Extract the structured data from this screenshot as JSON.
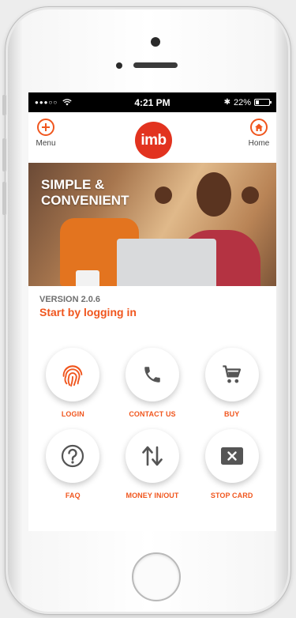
{
  "statusbar": {
    "time": "4:21 PM",
    "battery_text": "22%",
    "battery_level": 0.22
  },
  "appbar": {
    "menu_label": "Menu",
    "home_label": "Home",
    "logo_text": "imb"
  },
  "banner": {
    "headline_line1": "SIMPLE &",
    "headline_line2": "CONVENIENT"
  },
  "intro": {
    "version": "VERSION 2.0.6",
    "cta": "Start by logging in"
  },
  "actions": [
    {
      "label": "LOGIN",
      "icon": "fingerprint-icon"
    },
    {
      "label": "CONTACT US",
      "icon": "phone-icon"
    },
    {
      "label": "BUY",
      "icon": "cart-icon"
    },
    {
      "label": "FAQ",
      "icon": "question-icon"
    },
    {
      "label": "MONEY IN/OUT",
      "icon": "transfer-arrows-icon"
    },
    {
      "label": "STOP CARD",
      "icon": "stop-card-icon"
    }
  ],
  "colors": {
    "accent": "#f0561e",
    "logo": "#e2331f",
    "icon_dark": "#555555"
  }
}
